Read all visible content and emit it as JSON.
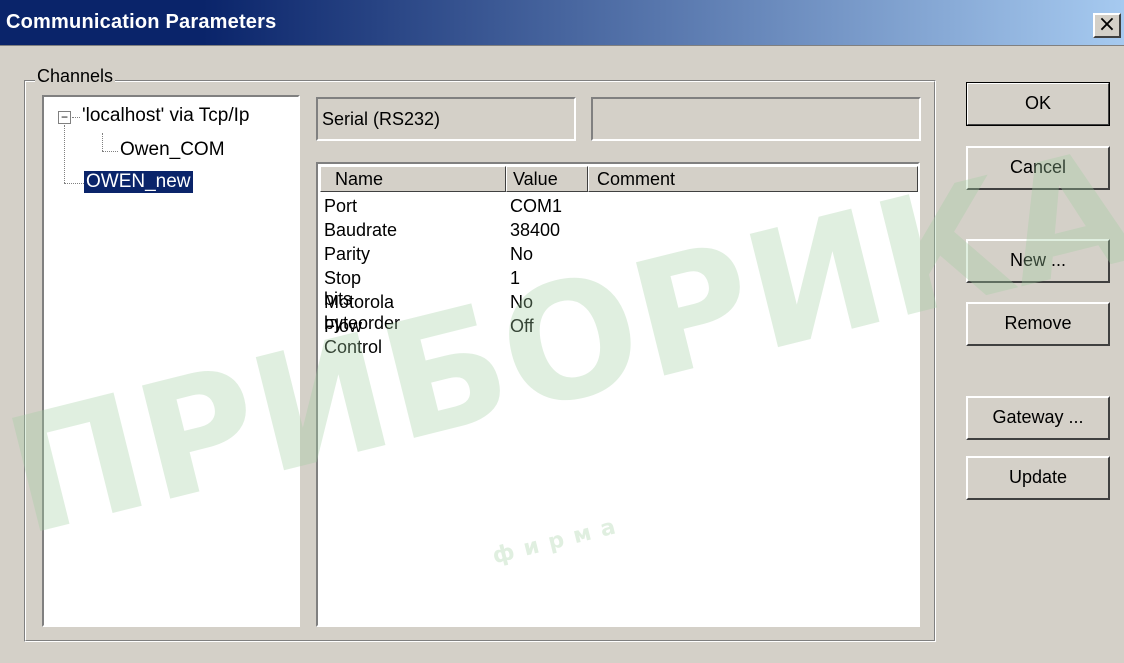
{
  "window": {
    "title": "Communication Parameters",
    "close_icon": "close-icon"
  },
  "channels": {
    "label": "Channels",
    "tree": [
      {
        "label": "'localhost' via Tcp/Ip",
        "expanded": true
      },
      {
        "label": "Owen_COM"
      },
      {
        "label": "OWEN_new",
        "selected": true
      }
    ]
  },
  "fields": {
    "device_type": "Serial (RS232)",
    "secondary": ""
  },
  "params_table": {
    "columns": [
      "Name",
      "Value",
      "Comment"
    ],
    "rows": [
      {
        "name": "Port",
        "value": "COM1",
        "comment": ""
      },
      {
        "name": "Baudrate",
        "value": "38400",
        "comment": ""
      },
      {
        "name": "Parity",
        "value": "No",
        "comment": ""
      },
      {
        "name": "Stop bits",
        "value": "1",
        "comment": ""
      },
      {
        "name": "Motorola byteorder",
        "value": "No",
        "comment": ""
      },
      {
        "name": "Flow Control",
        "value": "Off",
        "comment": ""
      }
    ]
  },
  "buttons": {
    "ok": "OK",
    "cancel": "Cancel",
    "new": "New ...",
    "remove": "Remove",
    "gateway": "Gateway ...",
    "update": "Update"
  },
  "watermark": {
    "text_main": "ПРИБОРИКА",
    "text_small": "фирма"
  },
  "colors": {
    "title_active": "#0a246a",
    "face": "#d4d0c8",
    "selection": "#0a246a"
  }
}
